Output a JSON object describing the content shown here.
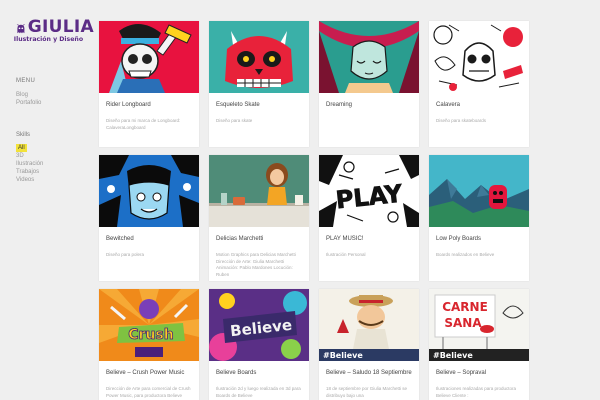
{
  "brand": {
    "name": "GIULIA",
    "subtitle": "Ilustración y Diseño",
    "color": "#5b2c86"
  },
  "menu": {
    "title": "MENU",
    "items": [
      {
        "label": "Blog"
      },
      {
        "label": "Portafolio"
      }
    ]
  },
  "skills": {
    "title": "Skills",
    "items": [
      {
        "label": "All",
        "active": true
      },
      {
        "label": "3D"
      },
      {
        "label": "Ilustración"
      },
      {
        "label": "Trabajos"
      },
      {
        "label": "Videos"
      }
    ]
  },
  "portfolio": {
    "items": [
      {
        "title": "Rider Longboard",
        "description": "Diseño para mi marca de Longboard: CalaveraLongboard"
      },
      {
        "title": "Esqueleto Skate",
        "description": "Diseño para skate"
      },
      {
        "title": "Dreaming",
        "description": ""
      },
      {
        "title": "Calavera",
        "description": "Diseño para skateboards"
      },
      {
        "title": "Bewitched",
        "description": "Diseño para polera"
      },
      {
        "title": "Delicias Marchetti",
        "description": "Motion Graphics para Delicias Marchetti Dirección de Arte: Giulia Marchetti Animación: Pablo Mardones Locución: Ruben"
      },
      {
        "title": "PLAY MUSIC!",
        "description": "Ilustración Personal"
      },
      {
        "title": "Low Poly Boards",
        "description": "Boards realizados en Believe"
      },
      {
        "title": "Believe – Crush Power Music",
        "description": "Dirección de Arte para comercial de Crush Power Music, para productora Believe"
      },
      {
        "title": "Believe Boards",
        "description": "Ilustración 2d y luego realizada en 3d para Boards de Believe"
      },
      {
        "title": "Believe – Saludo 18 Septiembre",
        "description": "18 de septiembre por Giulia Marchetti se distribuyo bajo una"
      },
      {
        "title": "Believe – Sopraval",
        "description": "Ilustraciones realizadas para productora Believe Cliente :"
      }
    ]
  },
  "artwork_text": {
    "play": "PLAY",
    "crush": "Crush",
    "believe": "Believe",
    "believe_hash": "#Believe",
    "carne": "CARNE",
    "sana": "SANA"
  }
}
